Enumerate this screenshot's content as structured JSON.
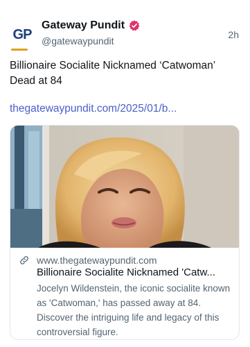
{
  "post": {
    "author": {
      "display_name": "Gateway Pundit",
      "handle": "@gatewaypundit",
      "avatar_text": "GP",
      "verified_icon": "verified-badge-icon"
    },
    "timestamp": "2h",
    "text": "Billionaire Socialite Nicknamed ‘Catwoman’ Dead at 84",
    "link_text": "thegatewaypundit.com/2025/01/b..."
  },
  "card": {
    "domain": "www.thegatewaypundit.com",
    "title": "Billionaire Socialite Nicknamed 'Catw...",
    "description": "Jocelyn Wildenstein, the iconic socialite known as 'Catwoman,' has passed away at 84. Discover the intriguing life and legacy of this controversial figure.",
    "link_icon": "link-icon"
  },
  "colors": {
    "link": "#4b5ec9",
    "verified": "#e1306c",
    "secondary_text": "#536471",
    "avatar_brand": "#1d3f7a",
    "avatar_accent": "#e0a11b"
  }
}
